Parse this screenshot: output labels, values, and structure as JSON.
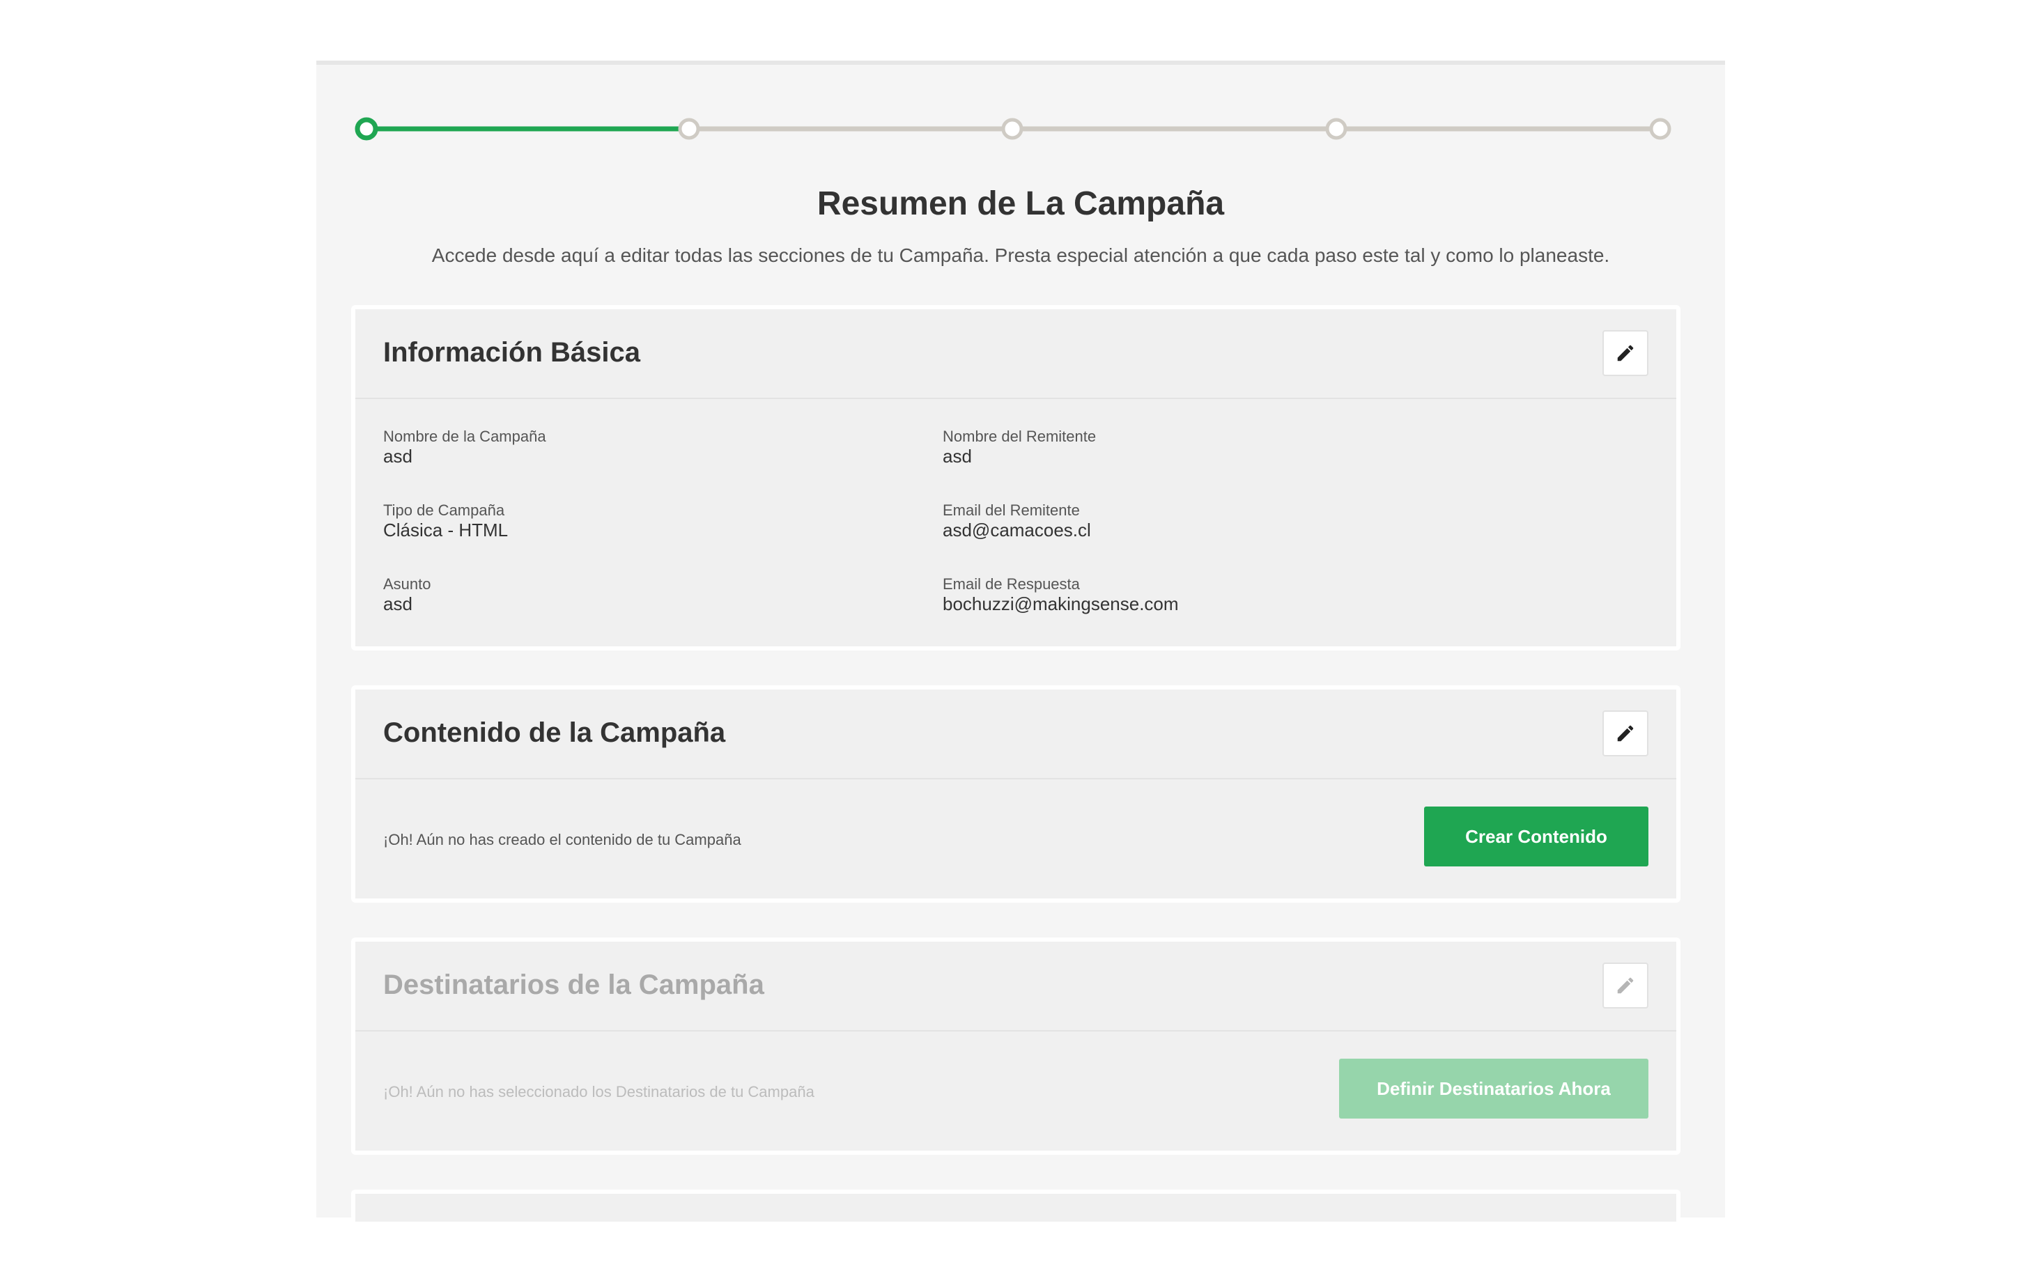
{
  "stepper": {
    "total_steps": 5,
    "current_step": 1
  },
  "summary": {
    "title": "Resumen de La Campaña",
    "subtitle": "Accede desde aquí a editar todas las secciones de tu Campaña. Presta especial atención a que cada paso este tal y como lo planeaste."
  },
  "basic_info": {
    "title": "Información Básica",
    "fields": [
      {
        "label": "Nombre de la Campaña",
        "value": "asd"
      },
      {
        "label": "Nombre del Remitente",
        "value": "asd"
      },
      {
        "label": "Tipo de Campaña",
        "value": "Clásica - HTML"
      },
      {
        "label": "Email del Remitente",
        "value": "asd@camacoes.cl"
      },
      {
        "label": "Asunto",
        "value": "asd"
      },
      {
        "label": "Email de Respuesta",
        "value": "bochuzzi@makingsense.com"
      }
    ]
  },
  "content": {
    "title": "Contenido de la Campaña",
    "message": "¡Oh! Aún no has creado el contenido de tu Campaña",
    "button_label": "Crear Contenido"
  },
  "recipients": {
    "title": "Destinatarios de la Campaña",
    "message": "¡Oh! Aún no has seleccionado los Destinatarios de tu Campaña",
    "button_label": "Definir Destinatarios Ahora"
  },
  "colors": {
    "accent_green": "#1fa652",
    "disabled_green": "#96d5ab",
    "step_inactive": "#cfcbc4"
  },
  "icons": {
    "edit": "pencil-icon"
  }
}
